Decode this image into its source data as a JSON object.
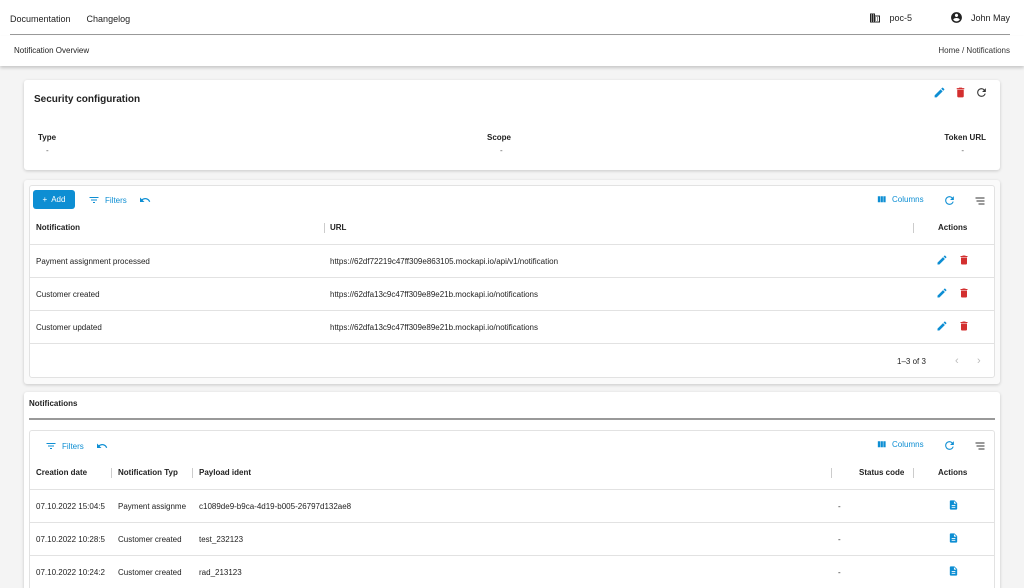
{
  "topbar": {
    "nav": [
      "Documentation",
      "Changelog"
    ],
    "tenant": "poc-5",
    "user": "John May"
  },
  "subbar": {
    "title": "Notification Overview",
    "breadcrumb": "Home  /  Notifications"
  },
  "security": {
    "title": "Security configuration",
    "fields": [
      {
        "label": "Type",
        "value": "-"
      },
      {
        "label": "Scope",
        "value": "-"
      },
      {
        "label": "Token URL",
        "value": "-"
      }
    ]
  },
  "webhooks": {
    "add_label": "Add",
    "filters_label": "Filters",
    "columns_label": "Columns",
    "headers": {
      "notification": "Notification",
      "url": "URL",
      "actions": "Actions"
    },
    "rows": [
      {
        "notification": "Payment assignment processed",
        "url": "https://62df72219c47ff309e863105.mockapi.io/api/v1/notification"
      },
      {
        "notification": "Customer created",
        "url": "https://62dfa13c9c47ff309e89e21b.mockapi.io/notifications"
      },
      {
        "notification": "Customer updated",
        "url": "https://62dfa13c9c47ff309e89e21b.mockapi.io/notifications"
      }
    ],
    "pagination": "1–3 of 3"
  },
  "notifications": {
    "title": "Notifications",
    "filters_label": "Filters",
    "columns_label": "Columns",
    "headers": {
      "date": "Creation date",
      "type": "Notification Typ",
      "payload": "Payload ident",
      "status": "Status code",
      "actions": "Actions"
    },
    "rows": [
      {
        "date": "07.10.2022 15:04:5",
        "type": "Payment assignme",
        "payload": "c1089de9-b9ca-4d19-b005-26797d132ae8",
        "status": "-"
      },
      {
        "date": "07.10.2022 10:28:5",
        "type": "Customer created",
        "payload": "test_232123",
        "status": "-"
      },
      {
        "date": "07.10.2022 10:24:2",
        "type": "Customer created",
        "payload": "rad_213123",
        "status": "-"
      }
    ]
  },
  "colors": {
    "accent": "#0d8ed3",
    "danger": "#d32f2f"
  }
}
